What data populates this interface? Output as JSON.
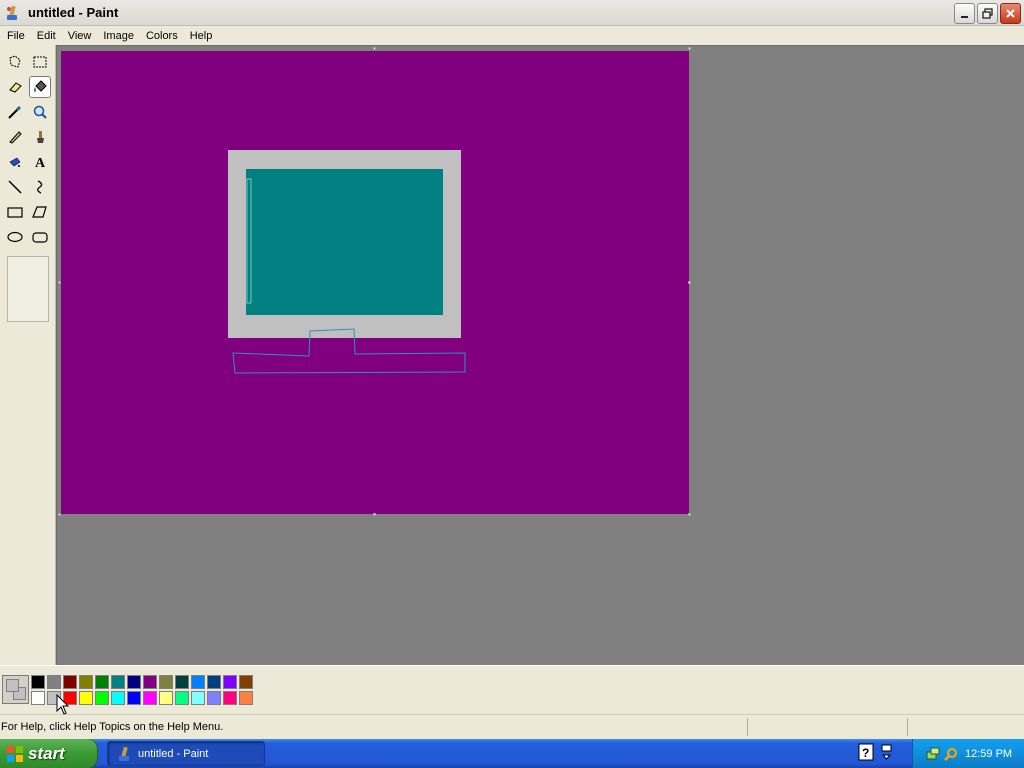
{
  "window": {
    "title": "untitled - Paint"
  },
  "menu": {
    "items": [
      "File",
      "Edit",
      "View",
      "Image",
      "Colors",
      "Help"
    ]
  },
  "tools": {
    "selected": "fill-with-color",
    "items": [
      "free-form-select",
      "select",
      "eraser",
      "fill-with-color",
      "pick-color",
      "magnifier",
      "pencil",
      "brush",
      "airbrush",
      "text",
      "line",
      "curve",
      "rectangle",
      "polygon",
      "ellipse",
      "rounded-rectangle"
    ]
  },
  "colors": {
    "canvas_background": "#800080",
    "monitor_frame": "#C0C0C0",
    "monitor_screen": "#008080",
    "foreground": "#C0C0C0",
    "background": "#C0C0C0"
  },
  "palette": {
    "row1": [
      "#000000",
      "#808080",
      "#800000",
      "#808000",
      "#008000",
      "#008080",
      "#000080",
      "#800080",
      "#808040",
      "#004040",
      "#0080FF",
      "#004080",
      "#8000FF",
      "#804000"
    ],
    "row2": [
      "#FFFFFF",
      "#C0C0C0",
      "#FF0000",
      "#FFFF00",
      "#00FF00",
      "#00FFFF",
      "#0000FF",
      "#FF00FF",
      "#FFFF80",
      "#00FF80",
      "#80FFFF",
      "#8080FF",
      "#FF0080",
      "#FF8040"
    ]
  },
  "status": {
    "help_text": "For Help, click Help Topics on the Help Menu."
  },
  "taskbar": {
    "start_label": "start",
    "task_label": "untitled - Paint",
    "clock": "12:59 PM"
  }
}
